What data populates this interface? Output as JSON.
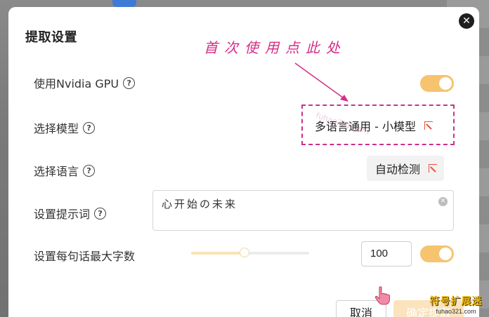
{
  "dialog": {
    "title": "提取设置",
    "close_glyph": "✕"
  },
  "annotation": {
    "text": "首次使用点此处",
    "color": "#d62e86"
  },
  "rows": {
    "gpu": {
      "label": "使用Nvidia GPU",
      "help": "?",
      "enabled": true
    },
    "model": {
      "label": "选择模型",
      "help": "?",
      "value": "多语言通用 - 小模型"
    },
    "language": {
      "label": "选择语言",
      "help": "?",
      "value": "自动检测"
    },
    "prompt": {
      "label": "设置提示词",
      "help": "?",
      "value": "心开始の未来",
      "clear_glyph": "✕"
    },
    "max_chars": {
      "label": "设置每句话最大字数",
      "help": "?",
      "value": "100",
      "slider_level": 0.45,
      "enabled": true
    }
  },
  "footer": {
    "cancel_label": "取消",
    "confirm_label": "确定提取"
  },
  "watermark": {
    "brand": "符号扩展迷",
    "domain": "fuhao321.com"
  },
  "colors": {
    "accent": "#f6c36e",
    "pick_icon": "#e8513d"
  }
}
